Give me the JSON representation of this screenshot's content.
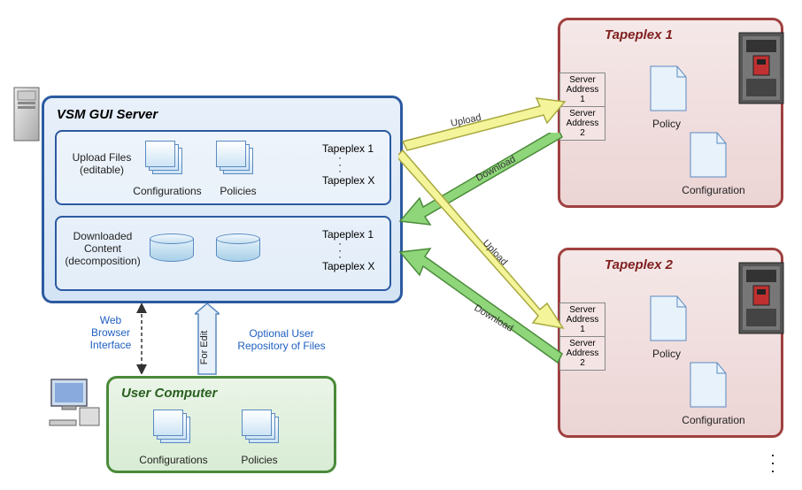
{
  "server_panel": {
    "title": "VSM GUI Server",
    "upload_label": "Upload Files\n(editable)",
    "configs_label": "Configurations",
    "policies_label": "Policies",
    "download_label": "Downloaded\nContent\n(decomposition)",
    "tapeplex_first": "Tapeplex 1",
    "tapeplex_last": "Tapeplex X"
  },
  "user_panel": {
    "title": "User Computer",
    "configs_label": "Configurations",
    "policies_label": "Policies"
  },
  "tapeplex1": {
    "title": "Tapeplex 1",
    "svr1": "Server\nAddress\n1",
    "svr2": "Server\nAddress\n2",
    "policy_label": "Policy",
    "config_label": "Configuration"
  },
  "tapeplex2": {
    "title": "Tapeplex 2",
    "svr1": "Server\nAddress\n1",
    "svr2": "Server\nAddress\n2",
    "policy_label": "Policy",
    "config_label": "Configuration"
  },
  "arrows": {
    "upload": "Upload",
    "download": "Download",
    "for_edit": "For Edit"
  },
  "side_labels": {
    "web_browser": "Web\nBrowser\nInterface",
    "optional_repo": "Optional User\nRepository of Files"
  }
}
